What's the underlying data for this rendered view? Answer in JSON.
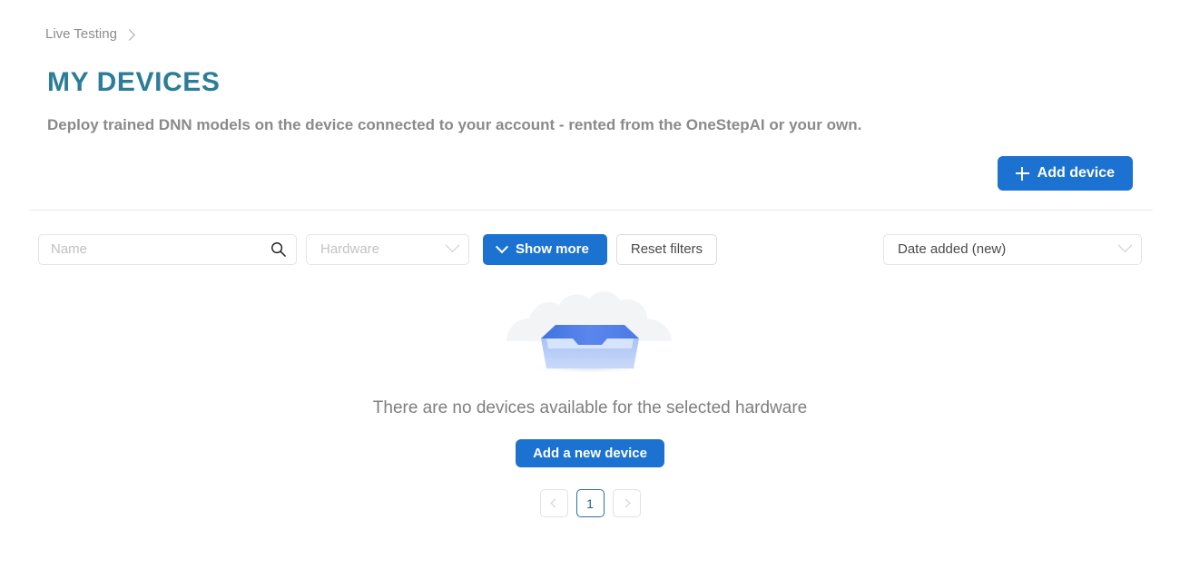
{
  "breadcrumb": {
    "items": [
      "Live Testing"
    ],
    "separator_icon": "chevron-right-icon"
  },
  "header": {
    "title": "MY DEVICES",
    "subtitle": "Deploy trained DNN models on the device connected to your account - rented from the OneStepAI or your own.",
    "title_color": "#2b7d99",
    "subtitle_color": "#8a8a8a"
  },
  "actions": {
    "add_device_label": "Add device",
    "add_device_icon": "plus-icon",
    "primary_color": "#1b72d1"
  },
  "filters": {
    "search": {
      "placeholder": "Name",
      "value": "",
      "icon": "search-icon"
    },
    "hardware": {
      "label": "Hardware",
      "value": "",
      "icon": "chevron-down-icon"
    },
    "show_more_label": "Show more",
    "show_more_icon": "chevron-down-icon",
    "reset_label": "Reset filters",
    "sort": {
      "value": "Date added (new)",
      "icon": "chevron-down-icon"
    }
  },
  "empty_state": {
    "illustration": "empty-inbox-tray-illustration",
    "message": "There are no devices available for the selected hardware",
    "button_label": "Add a new device"
  },
  "pagination": {
    "prev_icon": "chevron-left-icon",
    "next_icon": "chevron-right-icon",
    "pages": [
      "1"
    ],
    "current": "1",
    "prev_enabled": false,
    "next_enabled": false
  }
}
